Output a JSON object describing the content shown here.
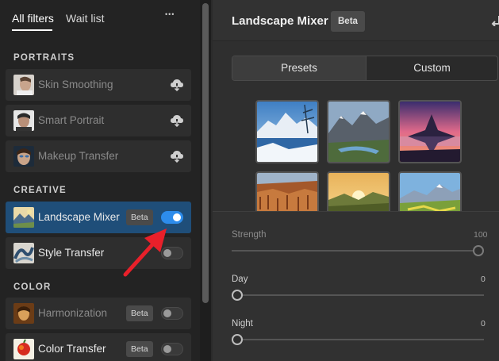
{
  "tabs": {
    "all_filters": "All filters",
    "wait_list": "Wait list",
    "more": "•••"
  },
  "sections": {
    "portraits": "PORTRAITS",
    "creative": "CREATIVE",
    "color": "COLOR"
  },
  "filters": {
    "skin_smoothing": {
      "label": "Skin Smoothing",
      "action_icon": "cloud-download-icon",
      "enabled": false
    },
    "smart_portrait": {
      "label": "Smart Portrait",
      "action_icon": "cloud-download-icon",
      "enabled": false
    },
    "makeup_transfer": {
      "label": "Makeup Transfer",
      "action_icon": "cloud-download-icon",
      "enabled": false
    },
    "landscape_mixer": {
      "label": "Landscape Mixer",
      "badge": "Beta",
      "toggle": true,
      "selected": true
    },
    "style_transfer": {
      "label": "Style Transfer",
      "toggle": false
    },
    "harmonization": {
      "label": "Harmonization",
      "badge": "Beta",
      "toggle": false,
      "enabled": false
    },
    "color_transfer": {
      "label": "Color Transfer",
      "badge": "Beta",
      "toggle": false
    }
  },
  "panel": {
    "title": "Landscape Mixer",
    "badge": "Beta",
    "back_icon": "undo-icon",
    "segments": {
      "presets": "Presets",
      "custom": "Custom",
      "active": "presets"
    },
    "presets": [
      {
        "name": "snowy-lake-preset"
      },
      {
        "name": "mountain-valley-preset"
      },
      {
        "name": "sunset-peak-preset"
      },
      {
        "name": "canyon-preset"
      },
      {
        "name": "sunrise-hills-preset"
      },
      {
        "name": "spring-mountain-preset"
      }
    ],
    "sliders": {
      "strength": {
        "label": "Strength",
        "value": "100",
        "fraction": 1.0
      },
      "day": {
        "label": "Day",
        "value": "0",
        "fraction": 0.0
      },
      "night": {
        "label": "Night",
        "value": "0",
        "fraction": 0.0
      }
    }
  },
  "colors": {
    "accent": "#2d8ceb",
    "selected_row": "#1f4e79",
    "annotation_arrow": "#e8202a"
  }
}
